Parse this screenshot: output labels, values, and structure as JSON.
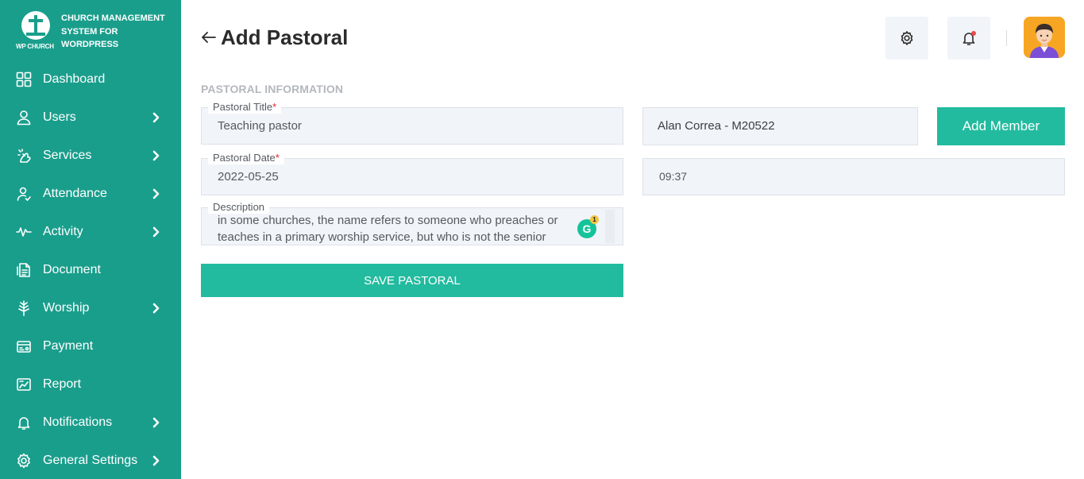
{
  "brand": {
    "logo_text": "WP CHURCH",
    "title": "CHURCH MANAGEMENT SYSTEM FOR WORDPRESS"
  },
  "sidebar": {
    "items": [
      {
        "label": "Dashboard",
        "icon": "dashboard-icon",
        "has_submenu": false
      },
      {
        "label": "Users",
        "icon": "user-icon",
        "has_submenu": true
      },
      {
        "label": "Services",
        "icon": "services-icon",
        "has_submenu": true
      },
      {
        "label": "Attendance",
        "icon": "attendance-icon",
        "has_submenu": true
      },
      {
        "label": "Activity",
        "icon": "activity-icon",
        "has_submenu": true
      },
      {
        "label": "Document",
        "icon": "document-icon",
        "has_submenu": false
      },
      {
        "label": "Worship",
        "icon": "worship-icon",
        "has_submenu": true
      },
      {
        "label": "Payment",
        "icon": "payment-icon",
        "has_submenu": false
      },
      {
        "label": "Report",
        "icon": "report-icon",
        "has_submenu": false
      },
      {
        "label": "Notifications",
        "icon": "bell-icon",
        "has_submenu": true
      },
      {
        "label": "General Settings",
        "icon": "gear-icon",
        "has_submenu": true
      }
    ]
  },
  "header": {
    "title": "Add Pastoral",
    "settings_icon": "gear-icon",
    "notification_icon": "bell-icon"
  },
  "form": {
    "section_label": "PASTORAL INFORMATION",
    "pastoral_title": {
      "label": "Pastoral Title",
      "required_mark": "*",
      "value": "Teaching pastor"
    },
    "pastoral_date": {
      "label": "Pastoral Date",
      "required_mark": "*",
      "value": "2022-05-25"
    },
    "description": {
      "label": "Description",
      "value": "in some churches, the name refers to someone who preaches or teaches in a primary worship service, but who is not the senior",
      "grammarly_count": "1"
    },
    "member": {
      "value": "Alan Correa - M20522"
    },
    "time": {
      "value": "09:37"
    },
    "add_member_label": "Add Member",
    "save_label": "SAVE PASTORAL"
  },
  "colors": {
    "sidebar_bg": "#1a9e8c",
    "accent": "#22bb9f",
    "field_bg": "#f1f4f8",
    "required": "#e02424"
  }
}
